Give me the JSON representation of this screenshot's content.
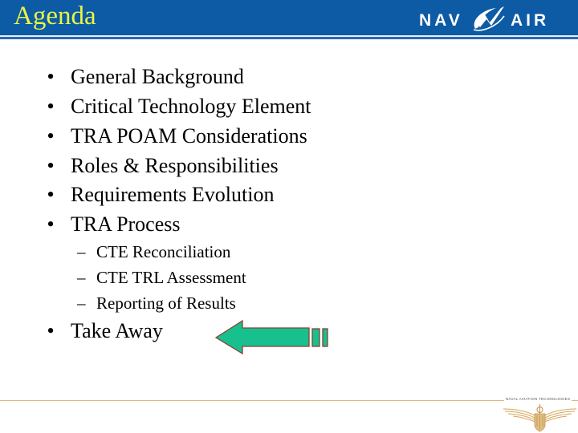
{
  "slide": {
    "title": "Agenda",
    "logo": {
      "left": "NAV",
      "right": "AIR",
      "icon": "navair-swoosh-icon"
    },
    "bullets": [
      {
        "label": "General Background"
      },
      {
        "label": "Critical Technology Element"
      },
      {
        "label": "TRA POAM Considerations"
      },
      {
        "label": "Roles & Responsibilities"
      },
      {
        "label": "Requirements Evolution"
      },
      {
        "label": "TRA Process"
      }
    ],
    "sub_bullets": [
      {
        "label": "CTE Reconciliation"
      },
      {
        "label": "CTE TRL Assessment"
      },
      {
        "label": "Reporting of Results"
      }
    ],
    "last_bullet": {
      "label": "Take Away"
    },
    "bullet_glyph": "•",
    "sub_glyph": "–",
    "arrow": {
      "icon": "left-arrow-icon",
      "fill": "#18c08e",
      "stroke": "#8a4030"
    },
    "footer": {
      "caption": "NAVAL AVIATION TECHNOLOGIES",
      "emblem": "naval-aviator-wings-icon"
    },
    "colors": {
      "header_blue": "#0d5aa5",
      "title_yellow": "#e8f542",
      "footer_gold": "#d9b98a"
    }
  }
}
